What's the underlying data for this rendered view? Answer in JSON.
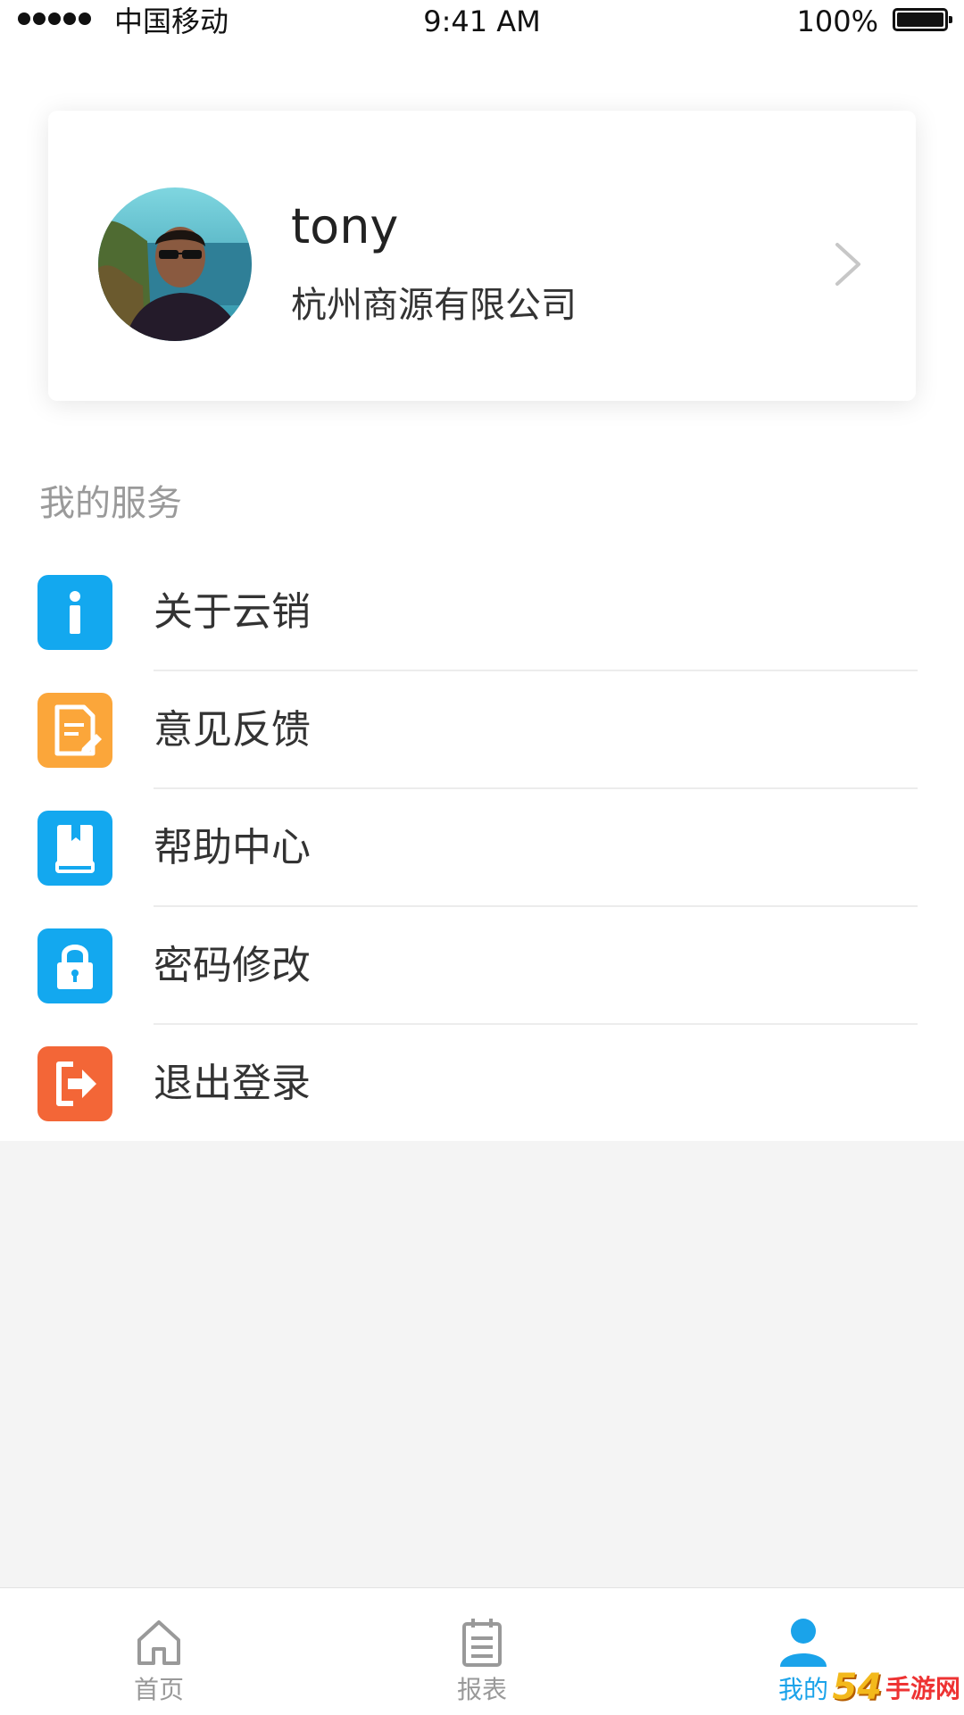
{
  "status_bar": {
    "carrier": "中国移动",
    "time": "9:41 AM",
    "battery": "100%"
  },
  "profile": {
    "name": "tony",
    "company": "杭州商源有限公司"
  },
  "services": {
    "title": "我的服务",
    "items": [
      {
        "label": "关于云销",
        "icon": "info-icon",
        "color": "#13a8ef"
      },
      {
        "label": "意见反馈",
        "icon": "feedback-edit-icon",
        "color": "#fba63a"
      },
      {
        "label": "帮助中心",
        "icon": "book-icon",
        "color": "#13a8ef"
      },
      {
        "label": "密码修改",
        "icon": "lock-icon",
        "color": "#13a8ef"
      },
      {
        "label": "退出登录",
        "icon": "logout-icon",
        "color": "#f36637"
      }
    ]
  },
  "tabbar": {
    "tabs": [
      {
        "label": "首页",
        "icon": "home-icon",
        "active": false
      },
      {
        "label": "报表",
        "icon": "report-icon",
        "active": false
      },
      {
        "label": "我的",
        "icon": "user-icon",
        "active": true
      }
    ],
    "active_color": "#1aa3ea",
    "inactive_color": "#999999"
  },
  "watermark": {
    "number": "54",
    "text": "手游网"
  }
}
